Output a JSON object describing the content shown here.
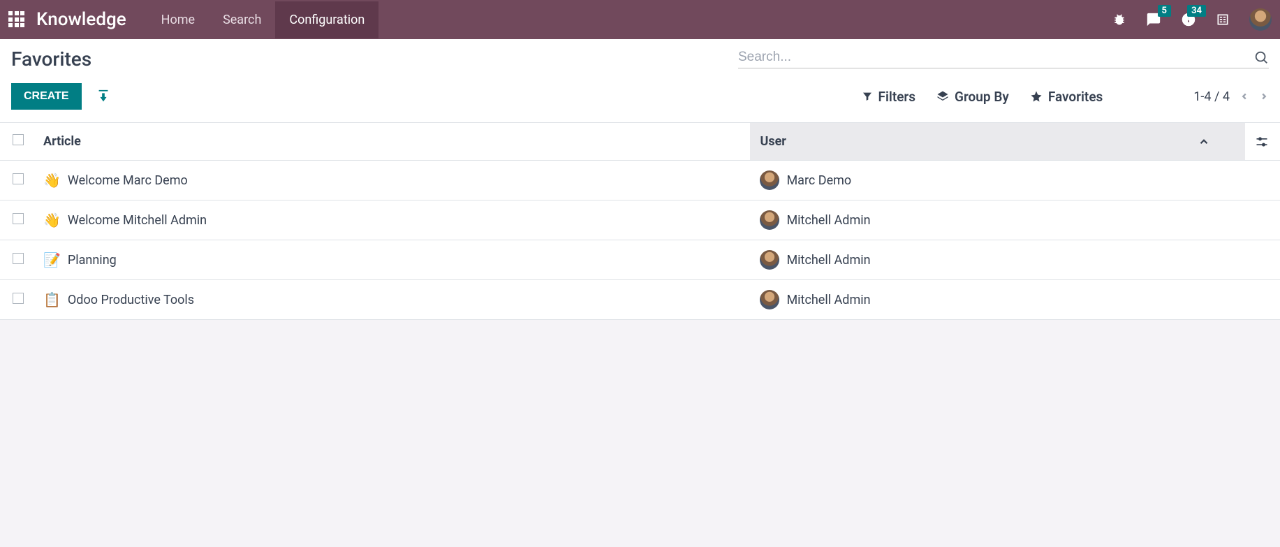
{
  "navbar": {
    "brand": "Knowledge",
    "links": [
      "Home",
      "Search",
      "Configuration"
    ],
    "active_index": 2,
    "messages_badge": "5",
    "activities_badge": "34"
  },
  "control_panel": {
    "breadcrumb": "Favorites",
    "search_placeholder": "Search...",
    "create_label": "CREATE",
    "filters_label": "Filters",
    "groupby_label": "Group By",
    "favorites_label": "Favorites",
    "pager_text": "1-4 / 4"
  },
  "table": {
    "headers": {
      "article": "Article",
      "user": "User"
    },
    "rows": [
      {
        "emoji": "👋",
        "article": "Welcome Marc Demo",
        "user": "Marc Demo"
      },
      {
        "emoji": "👋",
        "article": "Welcome Mitchell Admin",
        "user": "Mitchell Admin"
      },
      {
        "emoji": "📝",
        "article": "Planning",
        "user": "Mitchell Admin"
      },
      {
        "emoji": "📋",
        "article": "Odoo Productive Tools",
        "user": "Mitchell Admin"
      }
    ]
  }
}
